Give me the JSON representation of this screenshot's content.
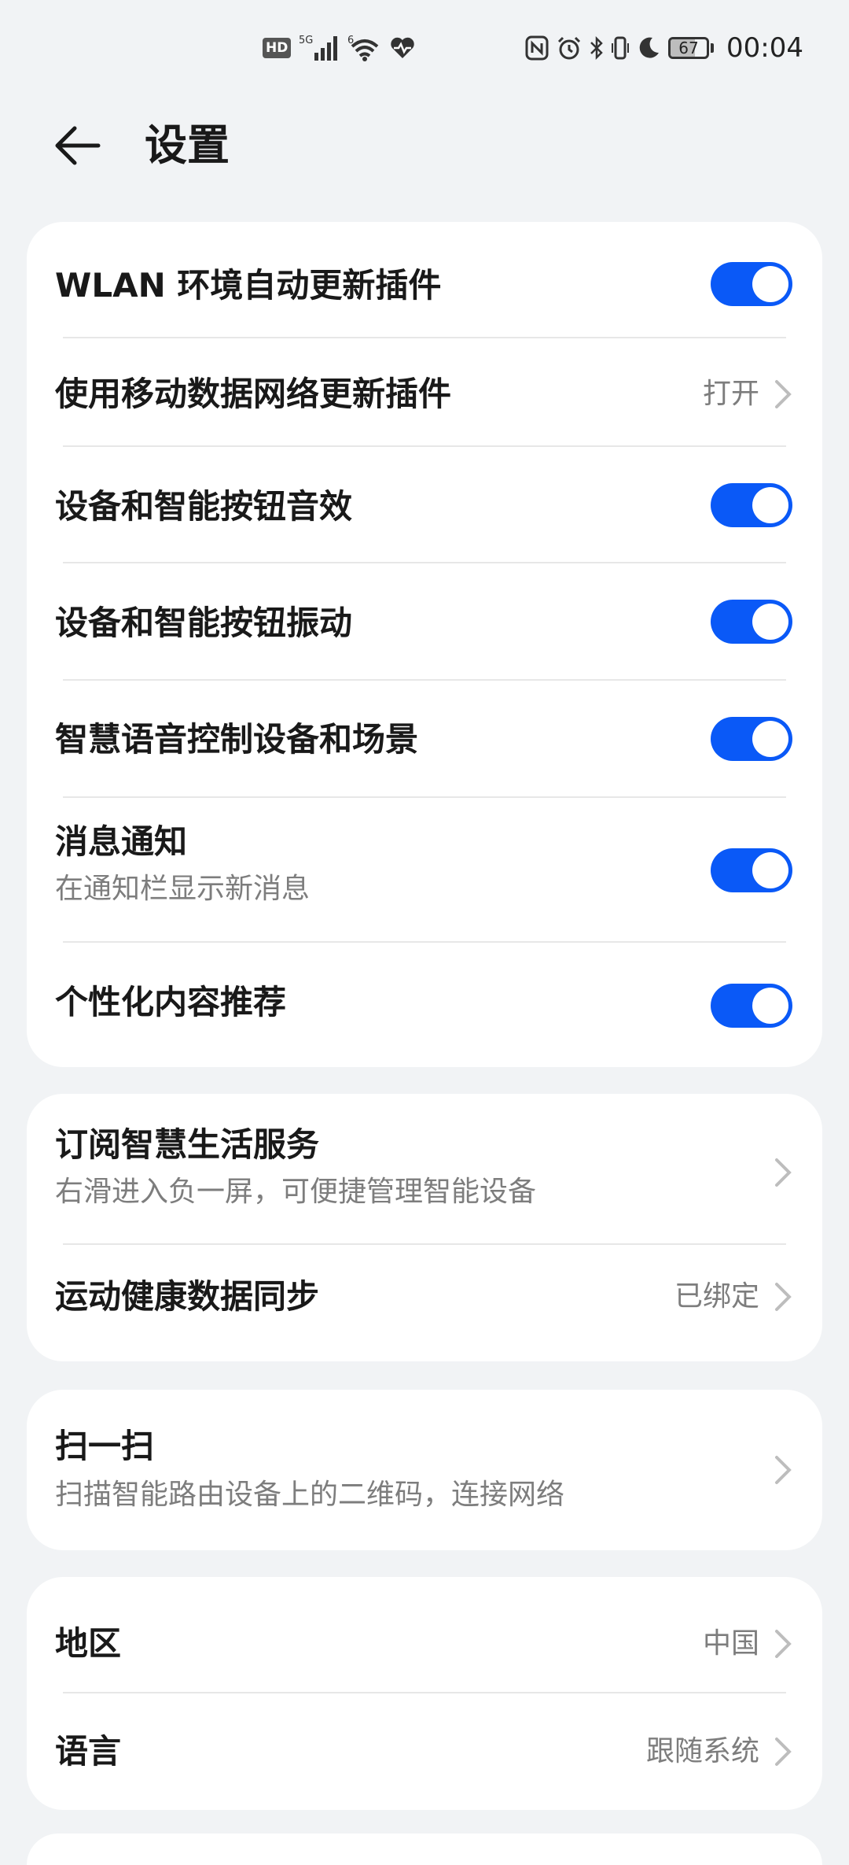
{
  "status_bar": {
    "left_icons": [
      "hd-icon",
      "signal-5g-icon",
      "wifi-icon",
      "health-heart-icon"
    ],
    "hd_label": "HD",
    "network_label": "5G",
    "wifi_label": "6",
    "right_icons": [
      "nfc-icon",
      "alarm-icon",
      "bluetooth-icon",
      "vibrate-icon",
      "moon-icon",
      "battery-icon"
    ],
    "battery_level": "67",
    "time": "00:04"
  },
  "header": {
    "back_icon": "arrow-left-icon",
    "title": "设置"
  },
  "card1": {
    "rows": [
      {
        "title": "WLAN 环境自动更新插件",
        "control": "toggle",
        "on": true
      },
      {
        "title": "使用移动数据网络更新插件",
        "value": "打开",
        "control": "chevron"
      },
      {
        "title": "设备和智能按钮音效",
        "control": "toggle",
        "on": true
      },
      {
        "title": "设备和智能按钮振动",
        "control": "toggle",
        "on": true
      },
      {
        "title": "智慧语音控制设备和场景",
        "control": "toggle",
        "on": true
      },
      {
        "title": "消息通知",
        "subtitle": "在通知栏显示新消息",
        "control": "toggle",
        "on": true
      },
      {
        "title": "个性化内容推荐",
        "control": "toggle",
        "on": true
      }
    ]
  },
  "card2": {
    "rows": [
      {
        "title": "订阅智慧生活服务",
        "subtitle": "右滑进入负一屏，可便捷管理智能设备",
        "control": "chevron"
      },
      {
        "title": "运动健康数据同步",
        "value": "已绑定",
        "control": "chevron"
      }
    ]
  },
  "card3": {
    "rows": [
      {
        "title": "扫一扫",
        "subtitle": "扫描智能路由设备上的二维码，连接网络",
        "control": "chevron"
      }
    ]
  },
  "card4": {
    "rows": [
      {
        "title": "地区",
        "value": "中国",
        "control": "chevron"
      },
      {
        "title": "语言",
        "value": "跟随系统",
        "control": "chevron"
      }
    ]
  },
  "colors": {
    "background": "#f1f3f5",
    "card": "#ffffff",
    "toggle_on": "#0a59f7",
    "text_primary": "#191919",
    "text_secondary": "#7d7d7d"
  }
}
